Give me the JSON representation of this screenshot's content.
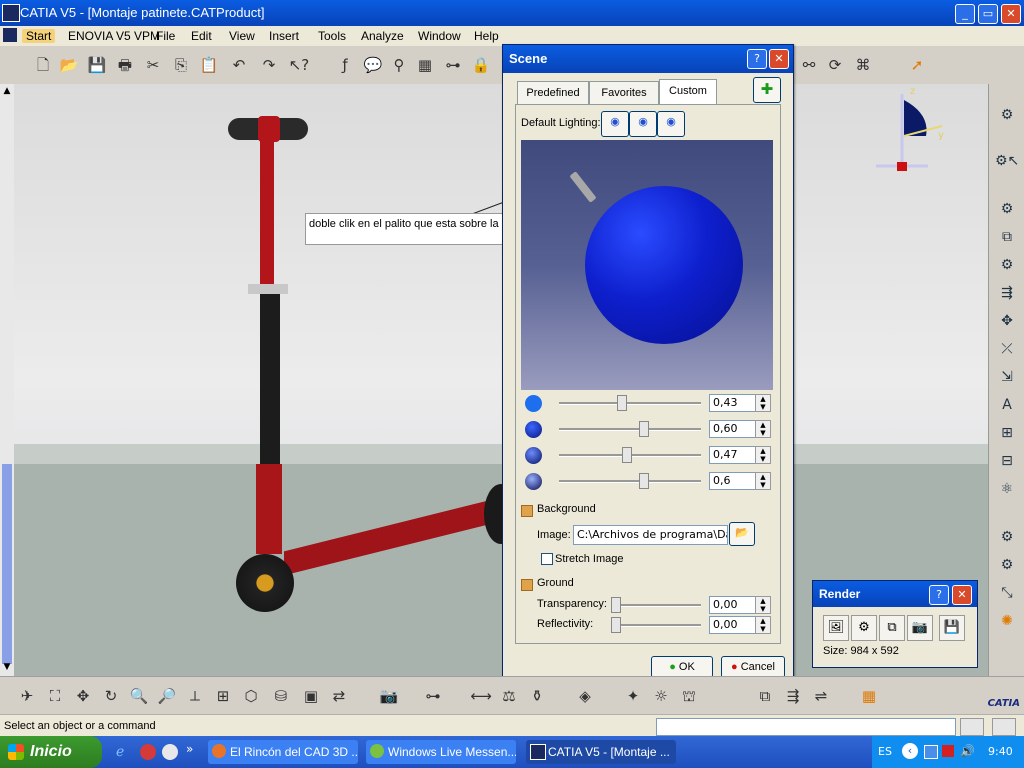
{
  "window": {
    "title": "CATIA V5 - [Montaje patinete.CATProduct]",
    "min_glyph": "_",
    "max_glyph": "▭",
    "close_glyph": "✕"
  },
  "menu": [
    "Start",
    "ENOVIA V5 VPM",
    "File",
    "Edit",
    "View",
    "Insert",
    "Tools",
    "Analyze",
    "Window",
    "Help"
  ],
  "toolbar_icons": [
    "new-icon",
    "open-icon",
    "save-icon",
    "print-icon",
    "cut-icon",
    "copy-icon",
    "paste-icon",
    "undo-icon",
    "redo-icon",
    "whats-this-icon",
    "formula-icon",
    "comment-icon",
    "knowledge-icon",
    "table-icon",
    "tree-icon",
    "lock-icon"
  ],
  "annotation": {
    "text": "doble clik en el palito que esta sobre la esfera"
  },
  "scene": {
    "title": "Scene",
    "help_glyph": "?",
    "close_glyph": "✕",
    "tabs": [
      "Predefined",
      "Favorites",
      "Custom"
    ],
    "selected_tab": "Custom",
    "default_lighting_label": "Default Lighting:",
    "sliders": [
      {
        "value": "0,43",
        "level": 0.43
      },
      {
        "value": "0,60",
        "level": 0.6
      },
      {
        "value": "0,47",
        "level": 0.47
      },
      {
        "value": "0,6",
        "level": 0.6
      }
    ],
    "background_label": "Background",
    "image_label": "Image:",
    "image_path": "C:\\Archivos de programa\\Dass",
    "stretch_label": "Stretch Image",
    "ground_label": "Ground",
    "transparency_label": "Transparency:",
    "transparency_value": "0,00",
    "reflectivity_label": "Reflectivity:",
    "reflectivity_value": "0,00",
    "ok_label": "OK",
    "cancel_label": "Cancel",
    "colors": {
      "sphere": "#0e1fcd",
      "title": "#0843b8"
    }
  },
  "render": {
    "title": "Render",
    "help_glyph": "?",
    "close_glyph": "✕",
    "size_text": "Size: 984 x 592"
  },
  "status": {
    "text": "Select an object or a command"
  },
  "taskbar": {
    "start_label": "Inicio",
    "tasks": [
      "El Rincón del CAD 3D ...",
      "Windows Live Messen...",
      "CATIA V5 - [Montaje ..."
    ],
    "language": "ES",
    "clock": "9:40"
  },
  "compass": {
    "z_label": "z",
    "y_label": "y"
  },
  "catia_logo": "CATIA"
}
